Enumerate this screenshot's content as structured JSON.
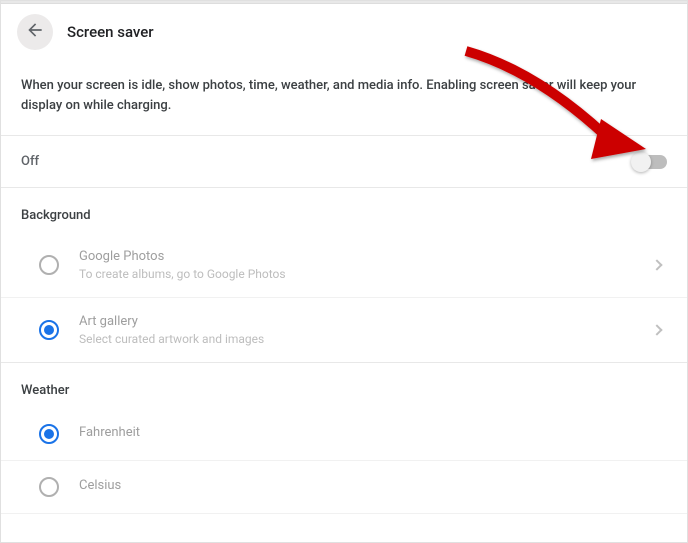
{
  "header": {
    "title": "Screen saver"
  },
  "description": "When your screen is idle, show photos, time, weather, and media info. Enabling screen saver will keep your display on while charging.",
  "toggle": {
    "label": "Off",
    "state": false
  },
  "sections": {
    "background": {
      "label": "Background",
      "options": [
        {
          "title": "Google Photos",
          "subtitle": "To create albums, go to Google Photos",
          "selected": false
        },
        {
          "title": "Art gallery",
          "subtitle": "Select curated artwork and images",
          "selected": true
        }
      ]
    },
    "weather": {
      "label": "Weather",
      "options": [
        {
          "title": "Fahrenheit",
          "selected": true
        },
        {
          "title": "Celsius",
          "selected": false
        }
      ]
    }
  },
  "annotation": {
    "arrow_color": "#cc0000"
  }
}
